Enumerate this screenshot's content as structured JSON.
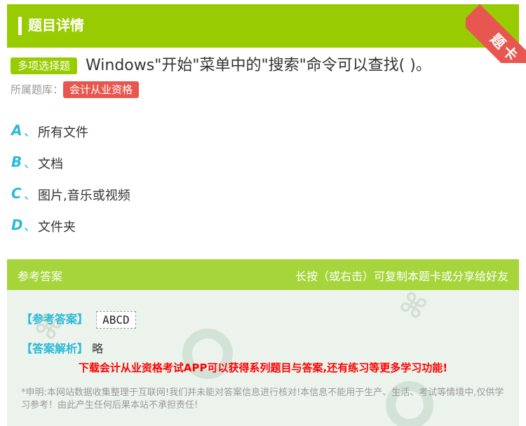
{
  "header": {
    "title": "题目详情",
    "ribbon": "题卡"
  },
  "question": {
    "type": "多项选择题",
    "text": "Windows\"开始\"菜单中的\"搜索\"命令可以查找( )。",
    "bank_label": "所属题库：",
    "bank": "会计从业资格"
  },
  "options": [
    {
      "letter": "A",
      "sep": "、",
      "text": "所有文件"
    },
    {
      "letter": "B",
      "sep": "、",
      "text": "文档"
    },
    {
      "letter": "C",
      "sep": "、",
      "text": "图片,音乐或视频"
    },
    {
      "letter": "D",
      "sep": "、",
      "text": "文件夹"
    }
  ],
  "answer": {
    "head_left": "参考答案",
    "head_right": "长按（或右击）可复制本题卡或分享给好友",
    "answer_label": "【参考答案】",
    "answer_value": "ABCD",
    "analysis_label": "【答案解析】",
    "analysis_value": "略",
    "promo": "下载会计从业资格考试APP可以获得系列题目与答案,还有练习等更多学习功能!",
    "disclaimer": "*申明:本网站数据收集整理于互联网!我们并未能对答案信息进行核对!本信息不能用于生产、生活、考试等情境中,仅供学习参考！由此产生任何后果本站不承担责任!"
  },
  "colors": {
    "green": "#99cc00",
    "red": "#e8574f",
    "cyan": "#2bbad8"
  }
}
